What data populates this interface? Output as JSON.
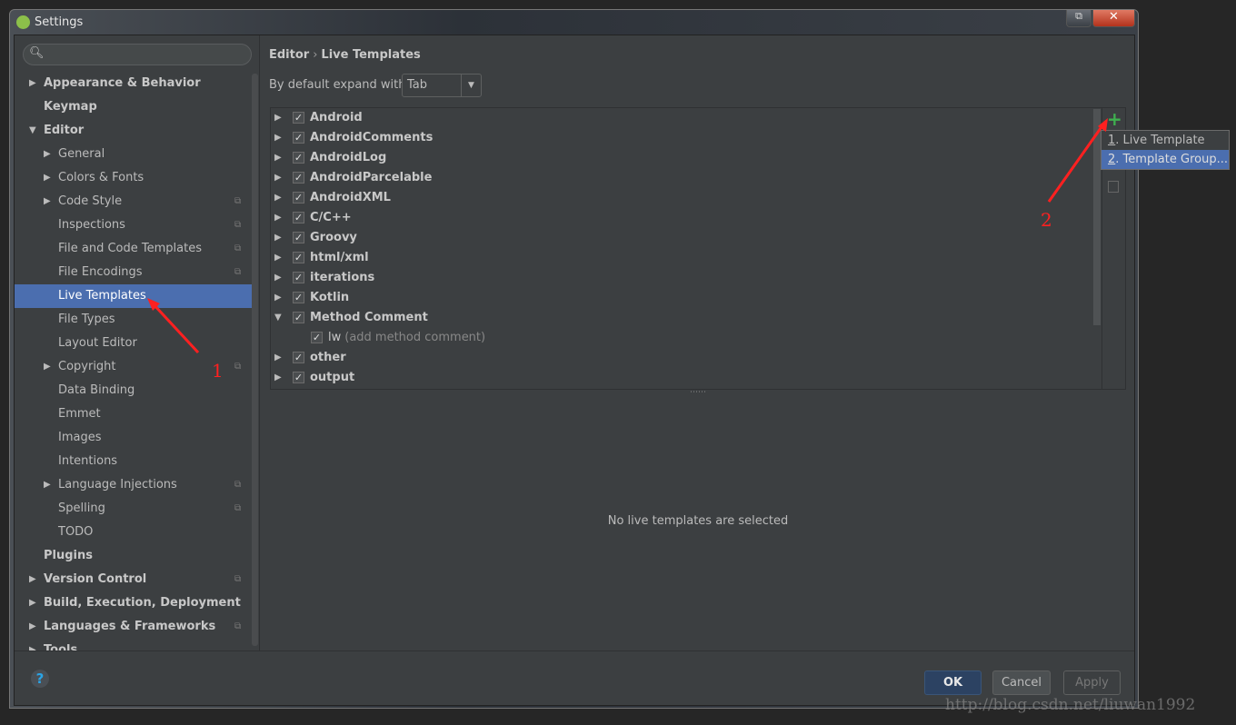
{
  "window": {
    "title": "Settings"
  },
  "sidebar": {
    "items": [
      {
        "label": "Appearance & Behavior",
        "level": 0,
        "bold": true,
        "arrow": "right",
        "copy": false
      },
      {
        "label": "Keymap",
        "level": 0,
        "bold": true,
        "arrow": "",
        "copy": false
      },
      {
        "label": "Editor",
        "level": 0,
        "bold": true,
        "arrow": "down",
        "copy": false
      },
      {
        "label": "General",
        "level": 1,
        "arrow": "right",
        "copy": false
      },
      {
        "label": "Colors & Fonts",
        "level": 1,
        "arrow": "right",
        "copy": false
      },
      {
        "label": "Code Style",
        "level": 1,
        "arrow": "right",
        "copy": true
      },
      {
        "label": "Inspections",
        "level": 1,
        "arrow": "",
        "copy": true
      },
      {
        "label": "File and Code Templates",
        "level": 1,
        "arrow": "",
        "copy": true
      },
      {
        "label": "File Encodings",
        "level": 1,
        "arrow": "",
        "copy": true
      },
      {
        "label": "Live Templates",
        "level": 1,
        "arrow": "",
        "copy": false,
        "selected": true
      },
      {
        "label": "File Types",
        "level": 1,
        "arrow": "",
        "copy": false
      },
      {
        "label": "Layout Editor",
        "level": 1,
        "arrow": "",
        "copy": false
      },
      {
        "label": "Copyright",
        "level": 1,
        "arrow": "right",
        "copy": true
      },
      {
        "label": "Data Binding",
        "level": 1,
        "arrow": "",
        "copy": false
      },
      {
        "label": "Emmet",
        "level": 1,
        "arrow": "",
        "copy": false
      },
      {
        "label": "Images",
        "level": 1,
        "arrow": "",
        "copy": false
      },
      {
        "label": "Intentions",
        "level": 1,
        "arrow": "",
        "copy": false
      },
      {
        "label": "Language Injections",
        "level": 1,
        "arrow": "right",
        "copy": true
      },
      {
        "label": "Spelling",
        "level": 1,
        "arrow": "",
        "copy": true
      },
      {
        "label": "TODO",
        "level": 1,
        "arrow": "",
        "copy": false
      },
      {
        "label": "Plugins",
        "level": 0,
        "bold": true,
        "arrow": "",
        "copy": false
      },
      {
        "label": "Version Control",
        "level": 0,
        "bold": true,
        "arrow": "right",
        "copy": true
      },
      {
        "label": "Build, Execution, Deployment",
        "level": 0,
        "bold": true,
        "arrow": "right",
        "copy": false
      },
      {
        "label": "Languages & Frameworks",
        "level": 0,
        "bold": true,
        "arrow": "right",
        "copy": true
      },
      {
        "label": "Tools",
        "level": 0,
        "bold": true,
        "arrow": "right",
        "copy": false
      }
    ]
  },
  "content": {
    "breadcrumb": [
      "Editor",
      "Live Templates"
    ],
    "breadcrumb_sep": "›",
    "expand_label": "By default expand with",
    "expand_value": "Tab",
    "templates": [
      {
        "name": "Android",
        "checked": true,
        "expanded": false
      },
      {
        "name": "AndroidComments",
        "checked": true,
        "expanded": false
      },
      {
        "name": "AndroidLog",
        "checked": true,
        "expanded": false
      },
      {
        "name": "AndroidParcelable",
        "checked": true,
        "expanded": false
      },
      {
        "name": "AndroidXML",
        "checked": true,
        "expanded": false
      },
      {
        "name": "C/C++",
        "checked": true,
        "expanded": false
      },
      {
        "name": "Groovy",
        "checked": true,
        "expanded": false
      },
      {
        "name": "html/xml",
        "checked": true,
        "expanded": false
      },
      {
        "name": "iterations",
        "checked": true,
        "expanded": false
      },
      {
        "name": "Kotlin",
        "checked": true,
        "expanded": false
      },
      {
        "name": "Method Comment",
        "checked": true,
        "expanded": true
      },
      {
        "name": "lw",
        "desc": "(add method comment)",
        "checked": true,
        "child": true
      },
      {
        "name": "other",
        "checked": true,
        "expanded": false
      },
      {
        "name": "output",
        "checked": true,
        "expanded": false
      }
    ],
    "empty_message": "No live templates are selected"
  },
  "popup": {
    "items": [
      {
        "mnemonic": "1",
        "label": ". Live Template"
      },
      {
        "mnemonic": "2",
        "label": ". Template Group..."
      }
    ]
  },
  "annotations": [
    "1",
    "2"
  ],
  "footer": {
    "ok": "OK",
    "cancel": "Cancel",
    "apply": "Apply",
    "help": "?"
  },
  "watermark": "http://blog.csdn.net/liuwan1992",
  "colors": {
    "selection": "#4b6eaf",
    "add": "#3fb04f",
    "annotation": "#ff2020"
  }
}
